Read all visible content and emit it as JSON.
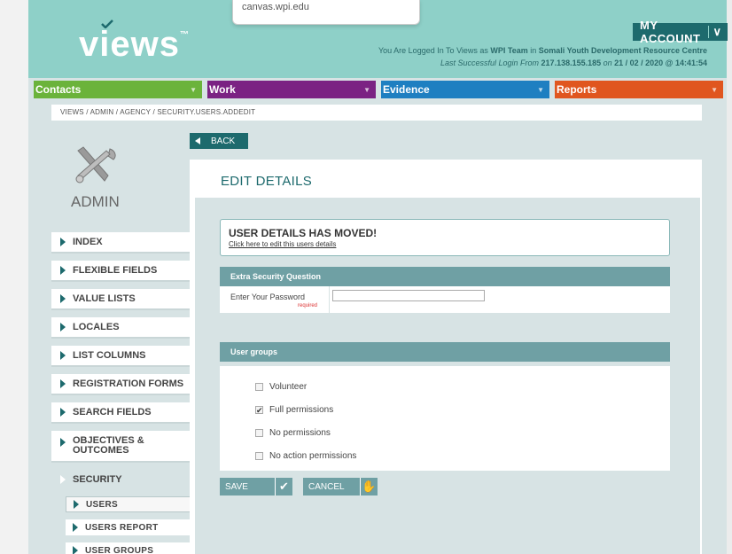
{
  "tooltip": {
    "text": "canvas.wpi.edu"
  },
  "header": {
    "logo": "views",
    "logo_tm": "™",
    "my_account": "MY ACCOUNT",
    "my_account_chevron": "∨",
    "login_prefix": "You Are Logged In To Views as ",
    "login_user": "WPI Team",
    "login_in": " in ",
    "login_org": "Somali Youth Development Resource Centre",
    "last_login_prefix": "Last Successful Login From ",
    "last_login_ip": "217.138.155.185",
    "last_login_on": " on ",
    "last_login_date": "21 / 02 / 2020 @ 14:41:54"
  },
  "nav": [
    {
      "label": "Contacts",
      "color": "#6bb33b"
    },
    {
      "label": "Work",
      "color": "#7b2283"
    },
    {
      "label": "Evidence",
      "color": "#1e7fc1"
    },
    {
      "label": "Reports",
      "color": "#e0561f"
    }
  ],
  "breadcrumb": "VIEWS / ADMIN / AGENCY / SECURITY.USERS.ADDEDIT",
  "sidebar": {
    "title": "ADMIN",
    "items": [
      {
        "label": "INDEX"
      },
      {
        "label": "FLEXIBLE FIELDS"
      },
      {
        "label": "VALUE LISTS"
      },
      {
        "label": "LOCALES"
      },
      {
        "label": "LIST COLUMNS"
      },
      {
        "label": "REGISTRATION FORMS"
      },
      {
        "label": "SEARCH FIELDS"
      },
      {
        "label": "OBJECTIVES & OUTCOMES"
      },
      {
        "label": "SECURITY"
      }
    ],
    "sub_items": [
      {
        "label": "USERS"
      },
      {
        "label": "USERS REPORT"
      },
      {
        "label": "USER GROUPS"
      }
    ]
  },
  "back_label": "BACK",
  "main": {
    "title": "EDIT DETAILS",
    "moved_title": "USER DETAILS HAS MOVED!",
    "moved_link": "Click here to edit this users details",
    "security_header": "Extra Security Question",
    "password_label": "Enter Your Password",
    "password_required": "required",
    "password_value": "",
    "groups_header": "User groups",
    "groups": [
      {
        "label": "Volunteer",
        "checked": false
      },
      {
        "label": "Full permissions",
        "checked": true
      },
      {
        "label": "No permissions",
        "checked": false
      },
      {
        "label": "No action permissions",
        "checked": false
      }
    ],
    "save_label": "SAVE",
    "cancel_label": "CANCEL"
  }
}
